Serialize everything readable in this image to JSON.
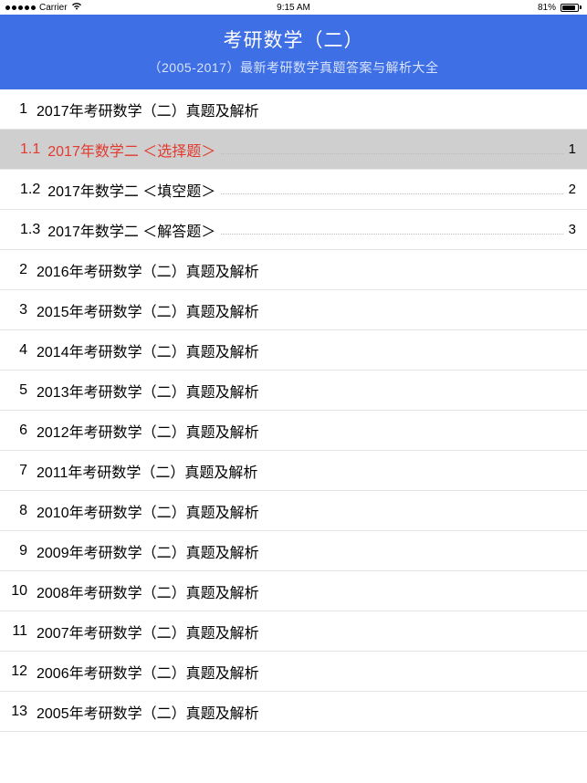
{
  "statusBar": {
    "carrier": "Carrier",
    "time": "9:15 AM",
    "batteryPercent": "81%"
  },
  "header": {
    "title": "考研数学（二）",
    "subtitle": "（2005-2017）最新考研数学真题答案与解析大全"
  },
  "toc": [
    {
      "num": "1",
      "label": "2017年考研数学（二）真题及解析",
      "children": [
        {
          "num": "1.1",
          "label": "2017年数学二 ＜选择题＞",
          "page": "1",
          "selected": true
        },
        {
          "num": "1.2",
          "label": "2017年数学二 ＜填空题＞",
          "page": "2",
          "selected": false
        },
        {
          "num": "1.3",
          "label": "2017年数学二 ＜解答题＞",
          "page": "3",
          "selected": false
        }
      ]
    },
    {
      "num": "2",
      "label": "2016年考研数学（二）真题及解析"
    },
    {
      "num": "3",
      "label": "2015年考研数学（二）真题及解析"
    },
    {
      "num": "4",
      "label": "2014年考研数学（二）真题及解析"
    },
    {
      "num": "5",
      "label": "2013年考研数学（二）真题及解析"
    },
    {
      "num": "6",
      "label": "2012年考研数学（二）真题及解析"
    },
    {
      "num": "7",
      "label": "2011年考研数学（二）真题及解析"
    },
    {
      "num": "8",
      "label": "2010年考研数学（二）真题及解析"
    },
    {
      "num": "9",
      "label": "2009年考研数学（二）真题及解析"
    },
    {
      "num": "10",
      "label": "2008年考研数学（二）真题及解析"
    },
    {
      "num": "11",
      "label": "2007年考研数学（二）真题及解析"
    },
    {
      "num": "12",
      "label": "2006年考研数学（二）真题及解析"
    },
    {
      "num": "13",
      "label": "2005年考研数学（二）真题及解析"
    }
  ]
}
